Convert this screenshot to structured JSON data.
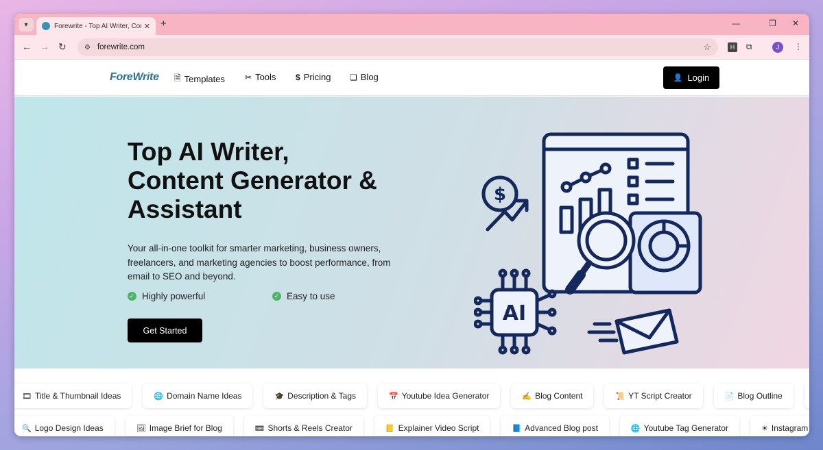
{
  "browser": {
    "tab_title": "Forewrite - Top AI Writer, Content Generator & Assistant",
    "url": "forewrite.com",
    "avatar_letter": "J",
    "extension_label": "H"
  },
  "header": {
    "logo": "ForeWrite",
    "nav": [
      {
        "label": "Templates",
        "icon": "document-icon"
      },
      {
        "label": "Tools",
        "icon": "tools-icon"
      },
      {
        "label": "Pricing",
        "icon": "dollar-icon"
      },
      {
        "label": "Blog",
        "icon": "copy-icon"
      }
    ],
    "login_label": "Login"
  },
  "hero": {
    "title_line1": "Top AI Writer,",
    "title_line2": "Content Generator &",
    "title_line3": "Assistant",
    "description": "Your all-in-one toolkit for smarter marketing, business owners, freelancers, and marketing agencies to boost performance, from email to SEO and beyond.",
    "features": [
      "Highly powerful",
      "Easy to use"
    ],
    "cta_label": "Get Started",
    "illustration_ai_label": "AI"
  },
  "chips": {
    "row1": [
      {
        "icon": "🎞",
        "label": "Title & Thumbnail Ideas"
      },
      {
        "icon": "🌐",
        "label": "Domain Name Ideas"
      },
      {
        "icon": "🎓",
        "label": "Description & Tags"
      },
      {
        "icon": "📅",
        "label": "Youtube Idea Generator"
      },
      {
        "icon": "✍",
        "label": "Blog Content"
      },
      {
        "icon": "📜",
        "label": "YT Script Creator"
      },
      {
        "icon": "📄",
        "label": "Blog Outline"
      },
      {
        "icon": "💬",
        "label": ""
      }
    ],
    "row2": [
      {
        "icon": "🔍",
        "label": "Logo Design Ideas"
      },
      {
        "icon": "🖼",
        "label": "Image Brief for Blog"
      },
      {
        "icon": "📼",
        "label": "Shorts & Reels Creator"
      },
      {
        "icon": "📒",
        "label": "Explainer Video Script"
      },
      {
        "icon": "📘",
        "label": "Advanced Blog post"
      },
      {
        "icon": "🌐",
        "label": "Youtube Tag Generator"
      },
      {
        "icon": "☀",
        "label": "Instagram Ca"
      }
    ]
  },
  "colors": {
    "brand": "#2e6f8f",
    "tab_strip": "#f8b4c3",
    "check": "#4fb36a",
    "illustration_stroke": "#14285c",
    "illustration_fill": "#dfe8fb"
  }
}
